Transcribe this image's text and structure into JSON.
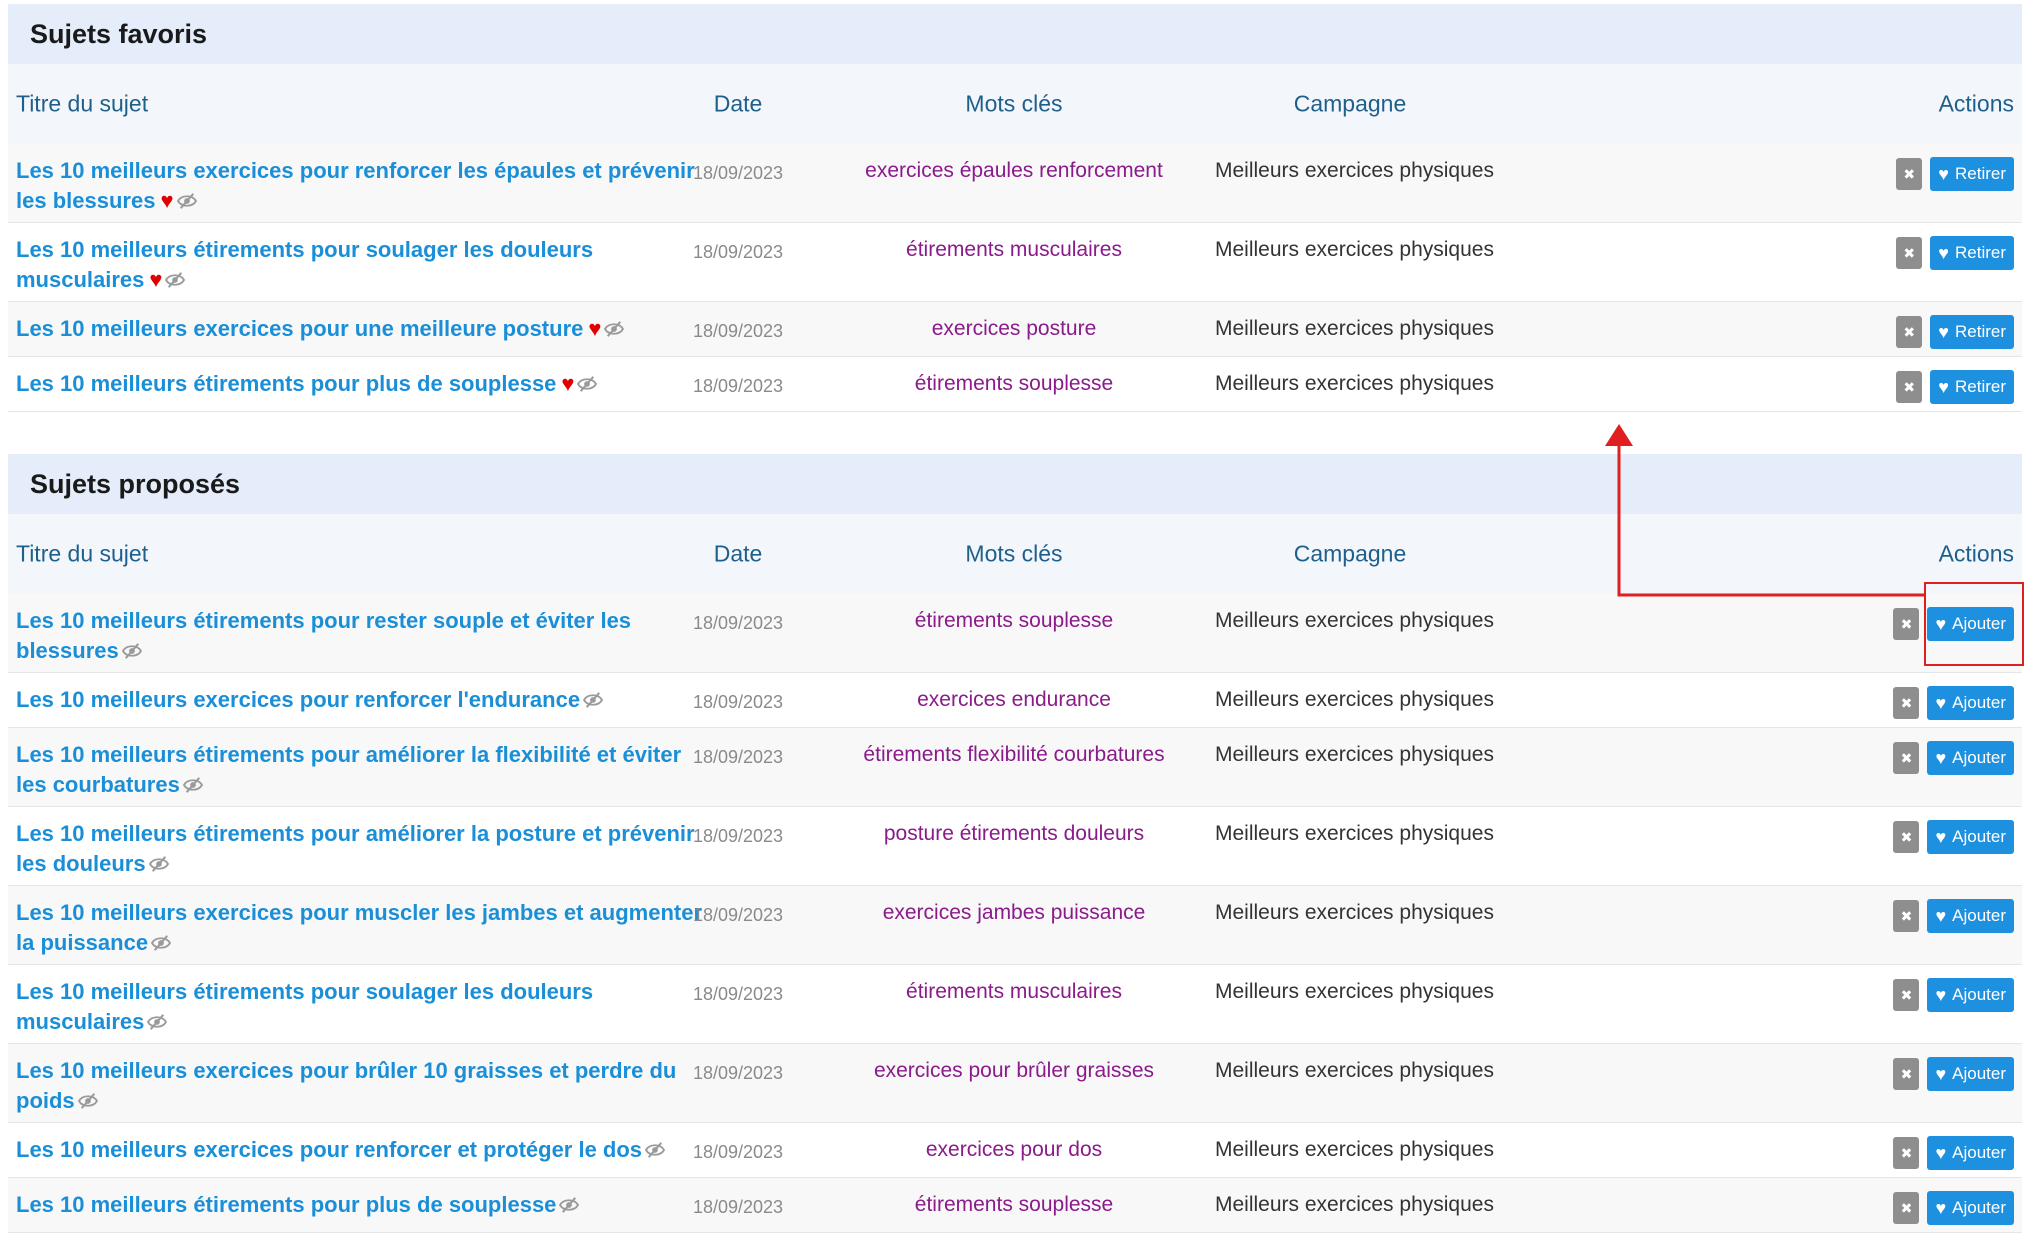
{
  "favorites": {
    "heading": "Sujets favoris",
    "columns": {
      "title": "Titre du sujet",
      "date": "Date",
      "keywords": "Mots clés",
      "campaign": "Campagne",
      "actions": "Actions"
    },
    "rows": [
      {
        "title": "Les 10 meilleurs exercices pour renforcer les épaules et prévenir les blessures",
        "date": "18/09/2023",
        "keywords": "exercices épaules renforcement",
        "campaign": "Meilleurs exercices physiques",
        "button": "Retirer"
      },
      {
        "title": "Les 10 meilleurs étirements pour soulager les douleurs musculaires",
        "date": "18/09/2023",
        "keywords": "étirements musculaires",
        "campaign": "Meilleurs exercices physiques",
        "button": "Retirer"
      },
      {
        "title": "Les 10 meilleurs exercices pour une meilleure posture",
        "date": "18/09/2023",
        "keywords": "exercices posture",
        "campaign": "Meilleurs exercices physiques",
        "button": "Retirer"
      },
      {
        "title": "Les 10 meilleurs étirements pour plus de souplesse",
        "date": "18/09/2023",
        "keywords": "étirements souplesse",
        "campaign": "Meilleurs exercices physiques",
        "button": "Retirer"
      }
    ]
  },
  "proposed": {
    "heading": "Sujets proposés",
    "columns": {
      "title": "Titre du sujet",
      "date": "Date",
      "keywords": "Mots clés",
      "campaign": "Campagne",
      "actions": "Actions"
    },
    "rows": [
      {
        "title": "Les 10 meilleurs étirements pour rester souple et éviter les blessures",
        "date": "18/09/2023",
        "keywords": "étirements souplesse",
        "campaign": "Meilleurs exercices physiques",
        "button": "Ajouter"
      },
      {
        "title": "Les 10 meilleurs exercices pour renforcer l'endurance",
        "date": "18/09/2023",
        "keywords": "exercices endurance",
        "campaign": "Meilleurs exercices physiques",
        "button": "Ajouter"
      },
      {
        "title": "Les 10 meilleurs étirements pour améliorer la flexibilité et éviter les courbatures",
        "date": "18/09/2023",
        "keywords": "étirements flexibilité courbatures",
        "campaign": "Meilleurs exercices physiques",
        "button": "Ajouter"
      },
      {
        "title": "Les 10 meilleurs étirements pour améliorer la posture et prévenir les douleurs",
        "date": "18/09/2023",
        "keywords": "posture étirements douleurs",
        "campaign": "Meilleurs exercices physiques",
        "button": "Ajouter"
      },
      {
        "title": "Les 10 meilleurs exercices pour muscler les jambes et augmenter la puissance",
        "date": "18/09/2023",
        "keywords": "exercices jambes puissance",
        "campaign": "Meilleurs exercices physiques",
        "button": "Ajouter"
      },
      {
        "title": "Les 10 meilleurs étirements pour soulager les douleurs musculaires",
        "date": "18/09/2023",
        "keywords": "étirements musculaires",
        "campaign": "Meilleurs exercices physiques",
        "button": "Ajouter"
      },
      {
        "title": "Les 10 meilleurs exercices pour brûler 10 graisses et perdre du poids",
        "date": "18/09/2023",
        "keywords": "exercices pour brûler graisses",
        "campaign": "Meilleurs exercices physiques",
        "button": "Ajouter"
      },
      {
        "title": "Les 10 meilleurs exercices pour renforcer et protéger le dos",
        "date": "18/09/2023",
        "keywords": "exercices pour dos",
        "campaign": "Meilleurs exercices physiques",
        "button": "Ajouter"
      },
      {
        "title": "Les 10 meilleurs étirements pour plus de souplesse",
        "date": "18/09/2023",
        "keywords": "étirements souplesse",
        "campaign": "Meilleurs exercices physiques",
        "button": "Ajouter"
      }
    ]
  },
  "icons": {
    "remove": "close-icon",
    "favorite": "heart-icon",
    "hidden": "eye-slash-icon"
  },
  "colors": {
    "title_link": "#1a8fd8",
    "keyword": "#8b1a8b",
    "button_blue": "#1e90e0",
    "favorite_heart": "#e00000",
    "annotation_red": "#e02020",
    "section_header_bg": "#e4edf9"
  }
}
